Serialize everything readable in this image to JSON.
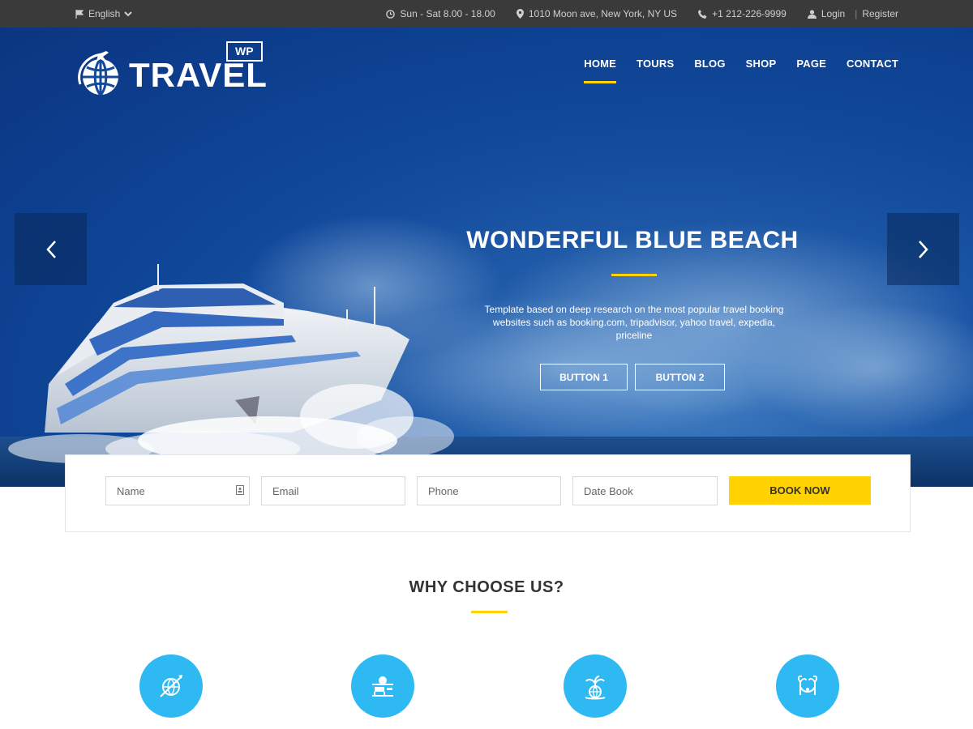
{
  "topbar": {
    "language": "English",
    "hours": "Sun - Sat 8.00 - 18.00",
    "address": "1010 Moon ave, New York, NY US",
    "phone": "+1 212-226-9999",
    "login": "Login",
    "register": "Register"
  },
  "logo": {
    "word": "TRAVEL",
    "badge": "WP"
  },
  "nav": {
    "items": [
      "HOME",
      "TOURS",
      "BLOG",
      "SHOP",
      "PAGE",
      "CONTACT"
    ],
    "active": "HOME"
  },
  "hero": {
    "title": "WONDERFUL BLUE BEACH",
    "description": "Template based on deep research on the most popular travel booking websites such as booking.com, tripadvisor, yahoo travel, expedia, priceline",
    "button1": "BUTTON 1",
    "button2": "BUTTON 2"
  },
  "booking": {
    "name_placeholder": "Name",
    "email_placeholder": "Email",
    "phone_placeholder": "Phone",
    "date_placeholder": "Date Book",
    "submit": "BOOK NOW"
  },
  "why": {
    "title": "WHY CHOOSE US?"
  },
  "colors": {
    "accent": "#ffd200",
    "hero_blue": "#124a9c",
    "feature_blue": "#2fb9f3",
    "topbar": "#3a3a3a"
  },
  "icons": [
    "flag-icon",
    "chevron-down-icon",
    "clock-icon",
    "map-pin-icon",
    "phone-icon",
    "user-icon",
    "chevron-left-icon",
    "chevron-right-icon",
    "id-card-icon",
    "plane-globe-icon",
    "beach-icon",
    "palm-globe-icon",
    "hammock-icon"
  ]
}
